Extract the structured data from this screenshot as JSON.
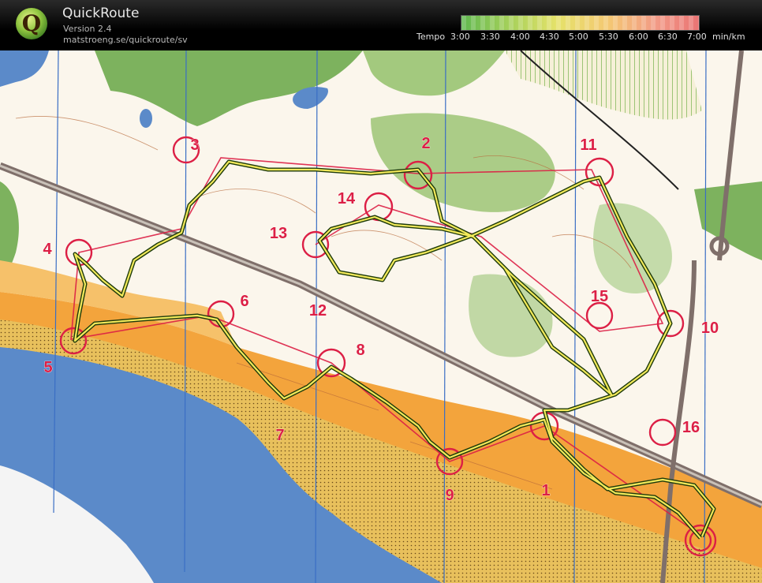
{
  "app": {
    "title": "QuickRoute",
    "version": "Version 2.4",
    "url": "matstroeng.se/quickroute/sv",
    "logo_letter": "Q"
  },
  "pace_legend": {
    "caption": "Tempo",
    "ticks": [
      "3:00",
      "3:30",
      "4:00",
      "4:30",
      "5:00",
      "5:30",
      "6:00",
      "6:30",
      "7:00"
    ],
    "unit": "min/km",
    "gradient": [
      "#5fb84f",
      "#a5d05a",
      "#e5e26a",
      "#f4c873",
      "#f29a86",
      "#ea7474"
    ]
  },
  "map": {
    "controls": [
      "1",
      "2",
      "3",
      "4",
      "5",
      "6",
      "7",
      "8",
      "9",
      "10",
      "11",
      "12",
      "13",
      "14",
      "15",
      "16"
    ],
    "colors": {
      "sea": "#5b8ac9",
      "sand": "#e8c05c",
      "open": "#f3a43c",
      "forest": "#fbf6ec",
      "green": "#7db25e",
      "control": "#dc1f45",
      "route": "#f2e95a",
      "road": "#7f6f6a"
    }
  }
}
